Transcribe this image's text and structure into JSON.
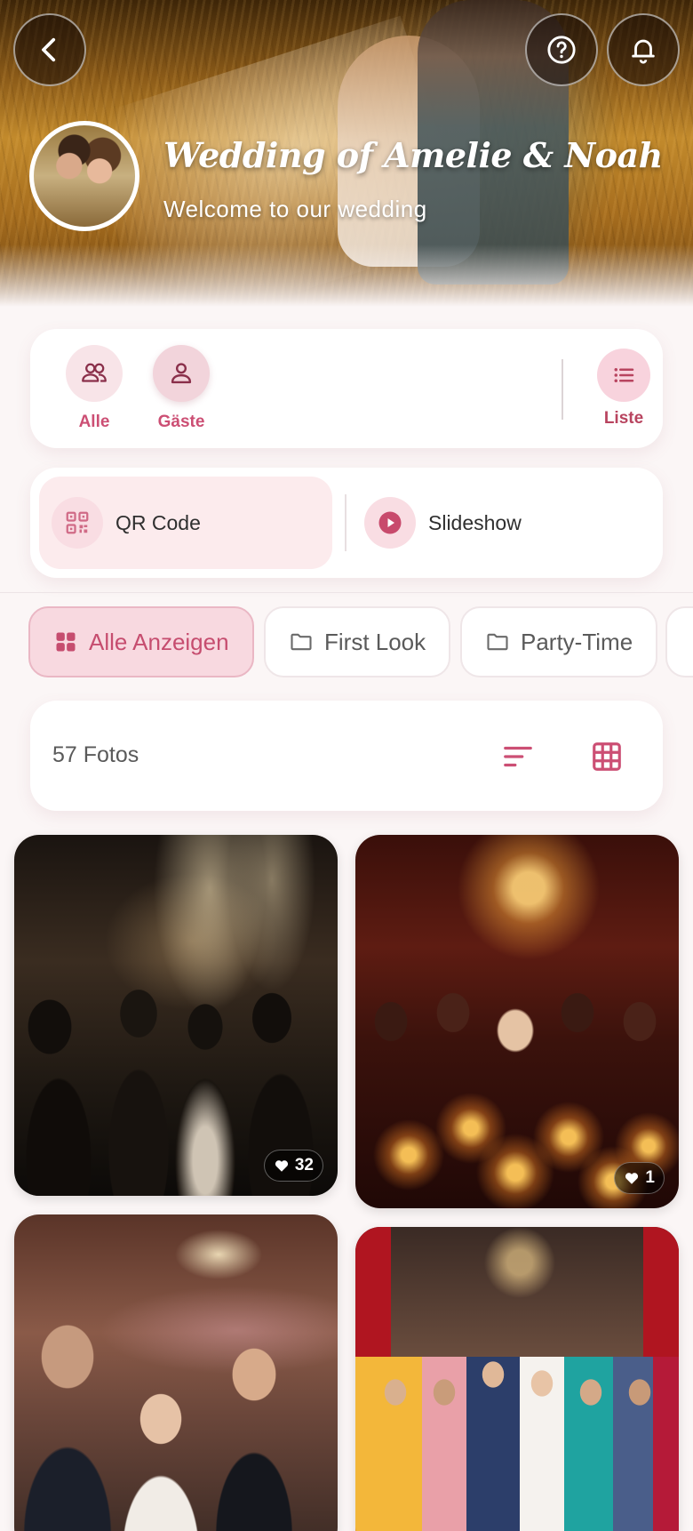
{
  "header": {
    "title": "Wedding of Amelie & Noah",
    "subtitle": "Welcome to our wedding"
  },
  "filters": {
    "items": [
      {
        "label": "Alle",
        "icon": "people-icon"
      },
      {
        "label": "Gäste",
        "icon": "person-icon"
      }
    ],
    "view_label": "Liste"
  },
  "actions": {
    "qr_label": "QR Code",
    "slideshow_label": "Slideshow"
  },
  "albums": [
    {
      "label": "Alle Anzeigen",
      "icon": "grid-icon",
      "active": true
    },
    {
      "label": "First Look",
      "icon": "folder-icon",
      "active": false
    },
    {
      "label": "Party-Time",
      "icon": "folder-icon",
      "active": false
    }
  ],
  "toolbar": {
    "count_label": "57 Fotos"
  },
  "photos": [
    {
      "likes": "32",
      "scene": "dance floor"
    },
    {
      "likes": "1",
      "scene": "candlelit dinner"
    },
    {
      "likes": null,
      "scene": "couple with guests"
    },
    {
      "likes": null,
      "scene": "wedding party group"
    }
  ],
  "colors": {
    "accent": "#cc4f74",
    "accent_light": "#f8d9e0",
    "background": "#fbf6f6"
  }
}
